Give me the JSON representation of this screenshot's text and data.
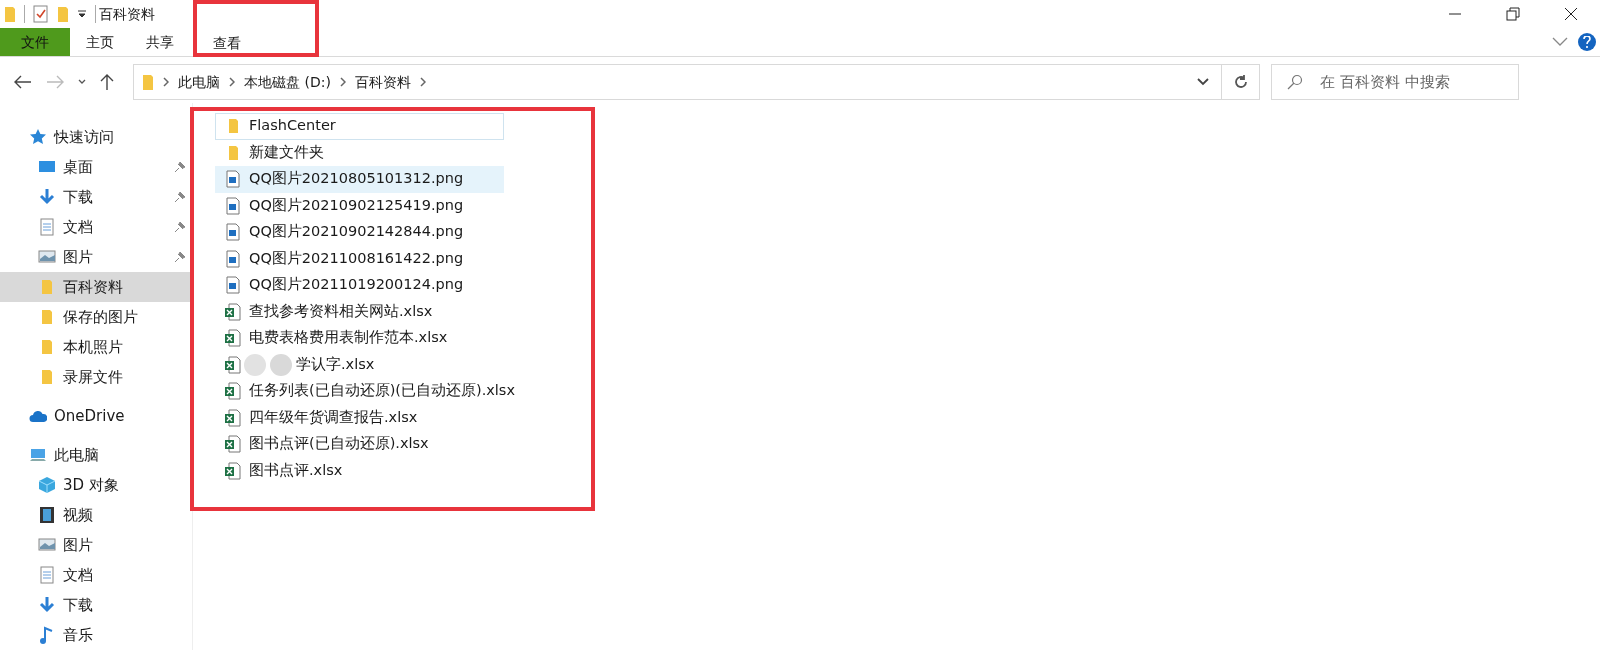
{
  "window": {
    "title": "百科资料"
  },
  "ribbon": {
    "tabs": [
      {
        "label": "文件",
        "kind": "file",
        "highlighted": false
      },
      {
        "label": "主页",
        "kind": "tab",
        "highlighted": false
      },
      {
        "label": "共享",
        "kind": "tab",
        "highlighted": false
      },
      {
        "label": "查看",
        "kind": "tab",
        "highlighted": true
      }
    ]
  },
  "address_bar": {
    "path": [
      "此电脑",
      "本地磁盘 (D:)",
      "百科资料"
    ]
  },
  "search": {
    "placeholder": "在 百科资料 中搜索"
  },
  "sidebar": {
    "items": [
      {
        "label": "快速访问",
        "kind": "star",
        "selected": false,
        "children": [
          {
            "label": "桌面",
            "kind": "desktop",
            "selected": false,
            "pinned": true
          },
          {
            "label": "下载",
            "kind": "download",
            "selected": false,
            "pinned": true
          },
          {
            "label": "文档",
            "kind": "document",
            "selected": false,
            "pinned": true
          },
          {
            "label": "图片",
            "kind": "picture",
            "selected": false,
            "pinned": true
          },
          {
            "label": "百科资料",
            "kind": "folder",
            "selected": true,
            "pinned": false
          },
          {
            "label": "保存的图片",
            "kind": "folder",
            "selected": false,
            "pinned": false
          },
          {
            "label": "本机照片",
            "kind": "folder",
            "selected": false,
            "pinned": false
          },
          {
            "label": "录屏文件",
            "kind": "folder",
            "selected": false,
            "pinned": false
          }
        ]
      },
      {
        "label": "OneDrive",
        "kind": "cloud",
        "selected": false
      },
      {
        "label": "此电脑",
        "kind": "computer",
        "selected": false,
        "children": [
          {
            "label": "3D 对象",
            "kind": "cube",
            "selected": false
          },
          {
            "label": "视频",
            "kind": "video",
            "selected": false
          },
          {
            "label": "图片",
            "kind": "picture",
            "selected": false
          },
          {
            "label": "文档",
            "kind": "document",
            "selected": false
          },
          {
            "label": "下载",
            "kind": "download",
            "selected": false
          },
          {
            "label": "音乐",
            "kind": "music",
            "selected": false
          }
        ]
      }
    ]
  },
  "file_list": {
    "highlighted": true,
    "files": [
      {
        "name": "FlashCenter",
        "kind": "folder",
        "selected": false,
        "focused": true,
        "redacted": false
      },
      {
        "name": "新建文件夹",
        "kind": "folder",
        "selected": false,
        "focused": false,
        "redacted": false
      },
      {
        "name": "QQ图片20210805101312.png",
        "kind": "image",
        "selected": true,
        "focused": false,
        "redacted": false
      },
      {
        "name": "QQ图片20210902125419.png",
        "kind": "image",
        "selected": false,
        "focused": false,
        "redacted": false
      },
      {
        "name": "QQ图片20210902142844.png",
        "kind": "image",
        "selected": false,
        "focused": false,
        "redacted": false
      },
      {
        "name": "QQ图片20211008161422.png",
        "kind": "image",
        "selected": false,
        "focused": false,
        "redacted": false
      },
      {
        "name": "QQ图片20211019200124.png",
        "kind": "image",
        "selected": false,
        "focused": false,
        "redacted": false
      },
      {
        "name": "查找参考资料相关网站.xlsx",
        "kind": "excel",
        "selected": false,
        "focused": false,
        "redacted": false
      },
      {
        "name": "电费表格费用表制作范本.xlsx",
        "kind": "excel",
        "selected": false,
        "focused": false,
        "redacted": false
      },
      {
        "name": "学认字.xlsx",
        "kind": "excel",
        "selected": false,
        "focused": false,
        "redacted": true
      },
      {
        "name": "任务列表(已自动还原)(已自动还原).xlsx",
        "kind": "excel",
        "selected": false,
        "focused": false,
        "redacted": false
      },
      {
        "name": "四年级年货调查报告.xlsx",
        "kind": "excel",
        "selected": false,
        "focused": false,
        "redacted": false
      },
      {
        "name": "图书点评(已自动还原).xlsx",
        "kind": "excel",
        "selected": false,
        "focused": false,
        "redacted": false
      },
      {
        "name": "图书点评.xlsx",
        "kind": "excel",
        "selected": false,
        "focused": false,
        "redacted": false
      }
    ]
  }
}
